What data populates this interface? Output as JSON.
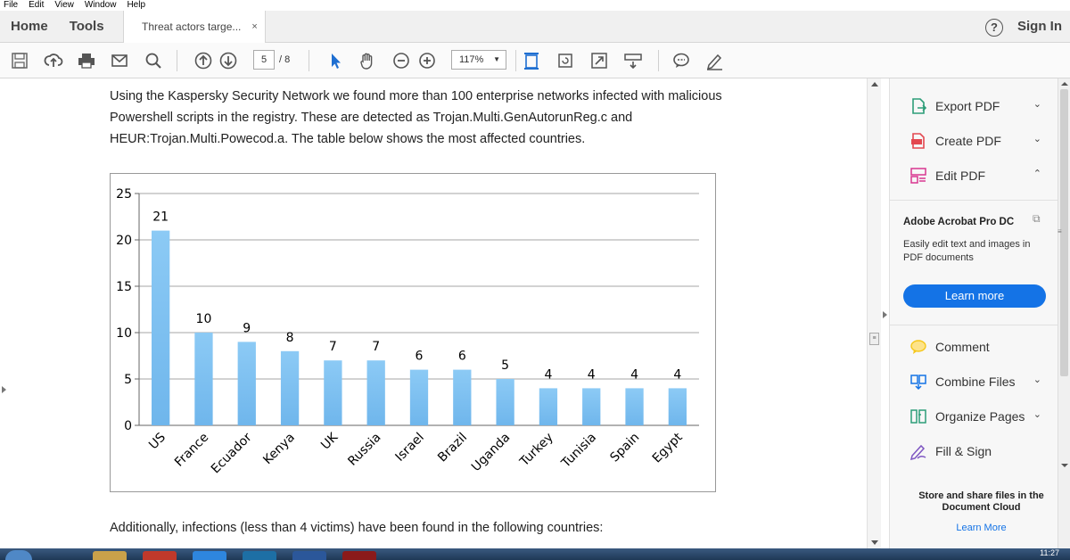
{
  "menu": [
    "File",
    "Edit",
    "View",
    "Window",
    "Help"
  ],
  "tabs": {
    "home": "Home",
    "tools": "Tools",
    "document": "Threat actors targe...",
    "close": "×"
  },
  "header": {
    "help": "?",
    "sign_in": "Sign In"
  },
  "toolbar": {
    "page_current": "5",
    "page_total": "/ 8",
    "zoom": "117%",
    "icons": [
      "save-icon",
      "upload-icon",
      "print-icon",
      "email-icon",
      "search-icon",
      "page-up-icon",
      "page-down-icon",
      "select-arrow-icon",
      "hand-icon",
      "zoom-out-icon",
      "zoom-in-icon",
      "fit-page-icon",
      "rotate-icon",
      "fullscreen-icon",
      "read-mode-icon",
      "comment-icon",
      "sign-icon"
    ]
  },
  "document": {
    "para1": "Using the Kaspersky Security Network we found more than 100 enterprise networks infected with malicious Powershell scripts in the registry. These are detected as Trojan.Multi.GenAutorunReg.c and HEUR:Trojan.Multi.Powecod.a. The table below shows the most affected countries.",
    "para2": "Additionally, infections (less than 4 victims) have been found in the following countries:"
  },
  "chart_data": {
    "type": "bar",
    "categories": [
      "US",
      "France",
      "Ecuador",
      "Kenya",
      "UK",
      "Russia",
      "Israel",
      "Brazil",
      "Uganda",
      "Turkey",
      "Tunisia",
      "Spain",
      "Egypt"
    ],
    "values": [
      21,
      10,
      9,
      8,
      7,
      7,
      6,
      6,
      5,
      4,
      4,
      4,
      4
    ],
    "ylim": [
      0,
      25
    ],
    "yticks": [
      0,
      5,
      10,
      15,
      20,
      25
    ],
    "grid": true,
    "legend": "none",
    "bar_color": "#6fb6ec",
    "data_labels": true
  },
  "right_pane": {
    "tools": [
      {
        "label": "Export PDF",
        "icon": "export-pdf-icon",
        "chevron": "expand",
        "color": "#2d9d78"
      },
      {
        "label": "Create PDF",
        "icon": "create-pdf-icon",
        "chevron": "expand",
        "color": "#e34850"
      },
      {
        "label": "Edit PDF",
        "icon": "edit-pdf-icon",
        "chevron": "collapse",
        "color": "#d83790"
      }
    ],
    "promo": {
      "title": "Adobe Acrobat Pro DC",
      "text": "Easily edit text and images in PDF documents",
      "button": "Learn more"
    },
    "tools2": [
      {
        "label": "Comment",
        "icon": "comment-icon",
        "chevron": "",
        "color": "#f5c71a"
      },
      {
        "label": "Combine Files",
        "icon": "combine-files-icon",
        "chevron": "expand",
        "color": "#1473e6"
      },
      {
        "label": "Organize Pages",
        "icon": "organize-pages-icon",
        "chevron": "expand",
        "color": "#2d9d78"
      },
      {
        "label": "Fill & Sign",
        "icon": "fill-sign-icon",
        "chevron": "",
        "color": "#7e56c2"
      }
    ],
    "store_text": "Store and share files in the Document Cloud",
    "learn_more_link": "Learn More",
    "chevron_expand": "⌄",
    "chevron_collapse": "⌃"
  },
  "taskbar": {
    "clock": "11:27"
  }
}
